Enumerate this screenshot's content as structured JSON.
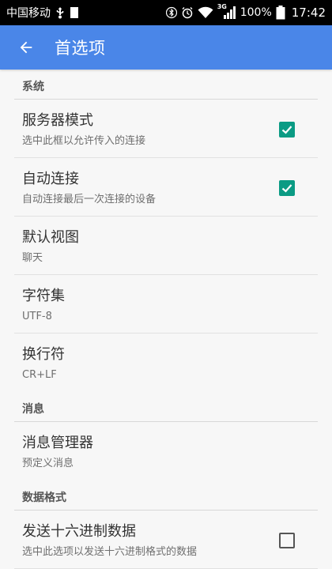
{
  "status_bar": {
    "carrier": "中国移动",
    "network_badge": "3G",
    "battery": "100%",
    "time": "17:42",
    "icons": [
      "usb-icon",
      "sim-icon",
      "bluetooth-icon",
      "alarm-icon",
      "wifi-icon",
      "signal-icon",
      "battery-icon"
    ]
  },
  "app_bar": {
    "title": "首选项",
    "back_icon": "arrow-left-icon",
    "background": "#4a86e8"
  },
  "sections": [
    {
      "header": "系统",
      "items": [
        {
          "title": "服务器模式",
          "summary": "选中此框以允许传入的连接",
          "checkbox": true
        },
        {
          "title": "自动连接",
          "summary": "自动连接最后一次连接的设备",
          "checkbox": true
        },
        {
          "title": "默认视图",
          "summary": "聊天"
        },
        {
          "title": "字符集",
          "summary": "UTF-8"
        },
        {
          "title": "换行符",
          "summary": "CR+LF"
        }
      ]
    },
    {
      "header": "消息",
      "items": [
        {
          "title": "消息管理器",
          "summary": "预定义消息"
        }
      ]
    },
    {
      "header": "数据格式",
      "items": [
        {
          "title": "发送十六进制数据",
          "summary": "选中此选项以发送十六进制格式的数据",
          "checkbox": false
        }
      ]
    }
  ],
  "colors": {
    "checkbox_checked": "#0b9b84",
    "background": "#f7f7f7"
  }
}
